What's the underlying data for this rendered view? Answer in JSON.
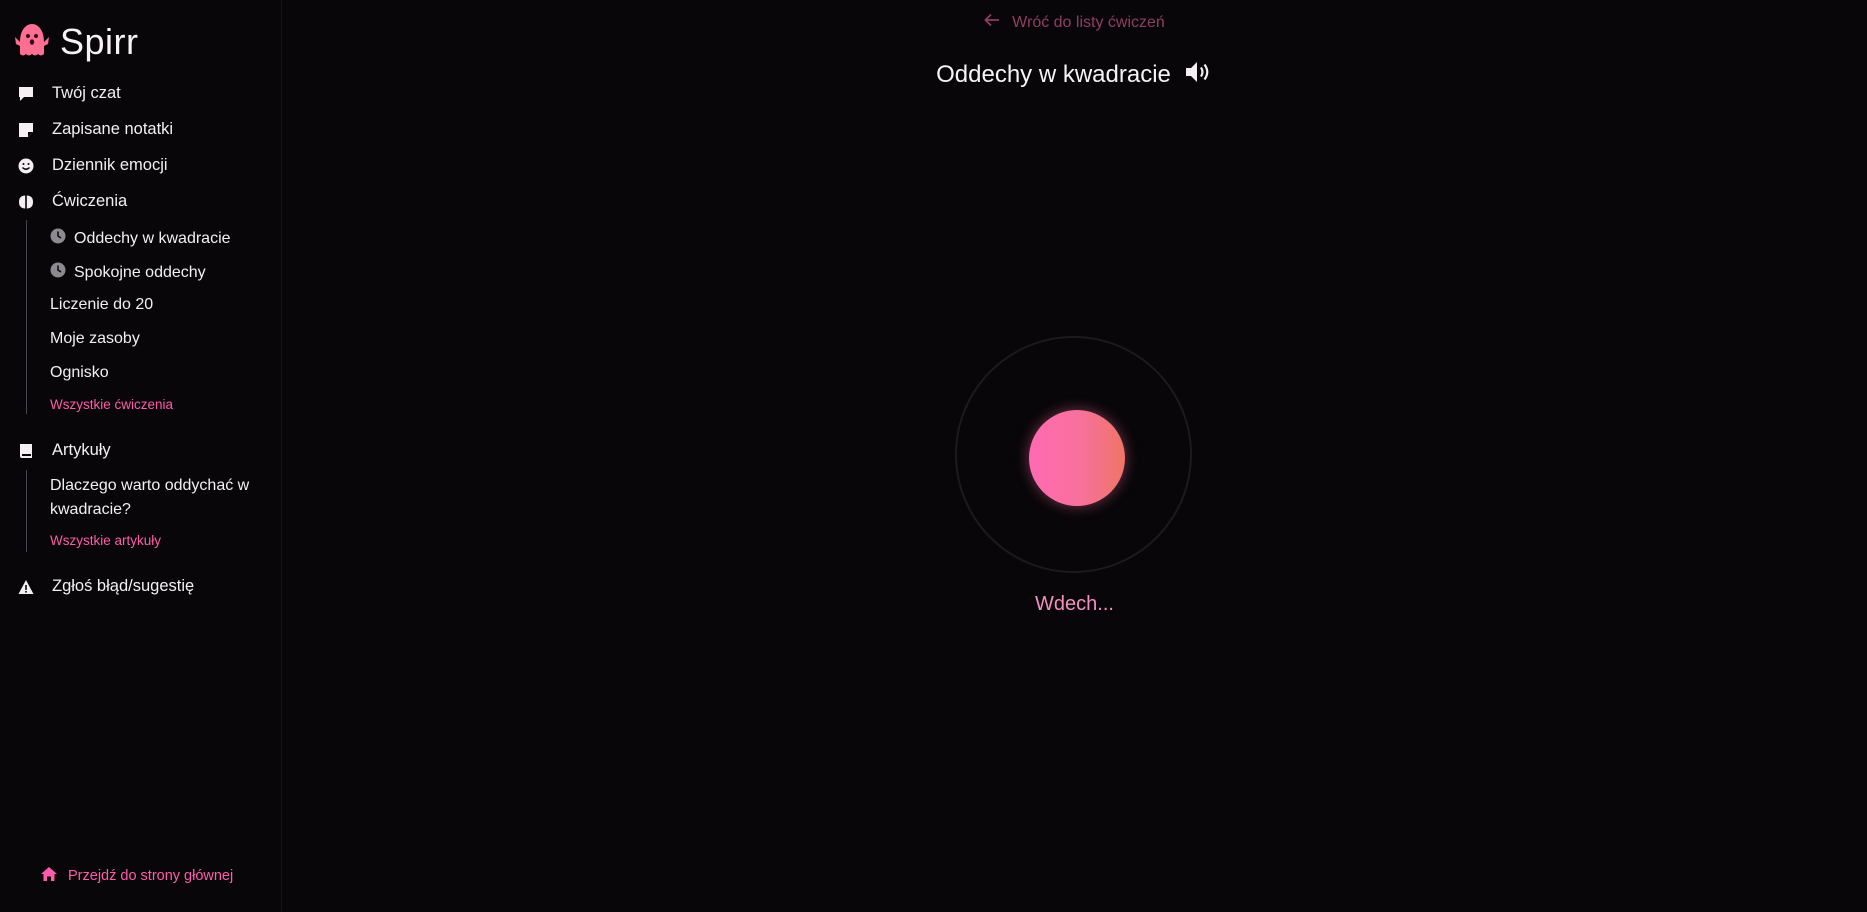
{
  "brand": {
    "name": "Spirr",
    "icon": "ghost-icon",
    "accent": "#ff5cab"
  },
  "sidebar": {
    "nav": [
      {
        "label": "Twój czat",
        "icon": "chat-bubble-icon"
      },
      {
        "label": "Zapisane notatki",
        "icon": "sticky-note-icon"
      },
      {
        "label": "Dziennik emocji",
        "icon": "smiley-icon"
      },
      {
        "label": "Ćwiczenia",
        "icon": "brain-icon"
      },
      {
        "label": "Artykuły",
        "icon": "book-icon"
      },
      {
        "label": "Zgłoś błąd/sugestię",
        "icon": "warning-icon"
      }
    ],
    "exercises": [
      {
        "label": "Oddechy w kwadracie",
        "icon": "clock-icon"
      },
      {
        "label": "Spokojne oddechy",
        "icon": "clock-icon"
      },
      {
        "label": "Liczenie do 20"
      },
      {
        "label": "Moje zasoby"
      },
      {
        "label": "Ognisko"
      }
    ],
    "all_exercises": "Wszystkie ćwiczenia",
    "articles": [
      {
        "label": "Dlaczego warto oddychać w kwadracie?"
      }
    ],
    "all_articles": "Wszystkie artykuły",
    "home_link": "Przejdź do strony głównej"
  },
  "main": {
    "back_link": "Wróć do listy ćwiczeń",
    "title": "Oddechy w kwadracie",
    "sound_icon": "speaker-volume-icon",
    "phase": "Wdech..."
  }
}
